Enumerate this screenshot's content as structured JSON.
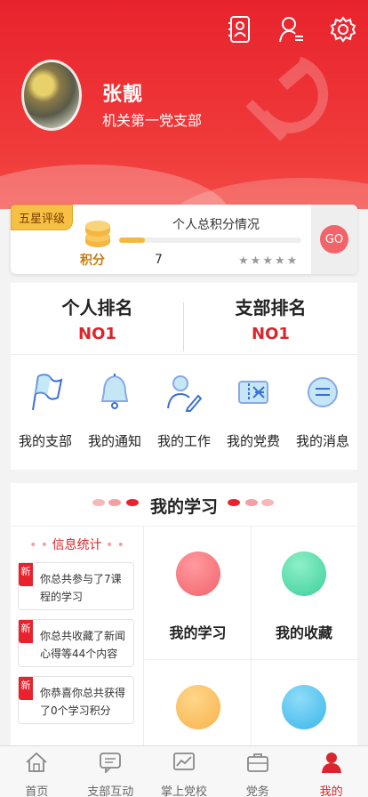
{
  "header": {
    "icons": [
      "contacts-icon",
      "user-list-icon",
      "settings-icon"
    ],
    "user_name": "张靓",
    "organization": "机关第一党支部"
  },
  "score_card": {
    "rating_badge": "五星评级",
    "points_label": "积分",
    "title": "个人总积分情况",
    "value": "7",
    "progress_fraction": 0.14,
    "stars_total": 5,
    "stars_filled": 0,
    "go_label": "GO"
  },
  "ranking": {
    "personal_label": "个人排名",
    "personal_value": "NO1",
    "branch_label": "支部排名",
    "branch_value": "NO1"
  },
  "menu": [
    {
      "label": "我的支部",
      "icon": "flag-icon"
    },
    {
      "label": "我的通知",
      "icon": "bell-icon"
    },
    {
      "label": "我的工作",
      "icon": "user-edit-icon"
    },
    {
      "label": "我的党费",
      "icon": "ticket-icon"
    },
    {
      "label": "我的消息",
      "icon": "message-icon"
    }
  ],
  "study": {
    "title": "我的学习",
    "info_title": "信息统计",
    "new_tag": "新",
    "info_items": [
      "你总共参与了7课程的学习",
      "你总共收藏了新闻心得等44个内容",
      "你恭喜你总共获得了0个学习积分"
    ],
    "tiles": [
      {
        "label": "我的学习",
        "icon": "book-icon",
        "color": "#f2646a"
      },
      {
        "label": "我的收藏",
        "icon": "cube-icon",
        "color": "#3ccf9a"
      },
      {
        "label": "",
        "icon": "points-icon",
        "color": "#f6b34a"
      },
      {
        "label": "",
        "icon": "cloud-download-icon",
        "color": "#39b6ea"
      }
    ]
  },
  "tabbar": [
    {
      "label": "首页",
      "icon": "home-icon",
      "active": false
    },
    {
      "label": "支部互动",
      "icon": "chat-icon",
      "active": false
    },
    {
      "label": "掌上党校",
      "icon": "chart-icon",
      "active": false
    },
    {
      "label": "党务",
      "icon": "briefcase-icon",
      "active": false
    },
    {
      "label": "我的",
      "icon": "person-icon",
      "active": true
    }
  ],
  "colors": {
    "primary": "#e8232d",
    "accent_text": "#d9262c",
    "gold": "#f6c045"
  }
}
